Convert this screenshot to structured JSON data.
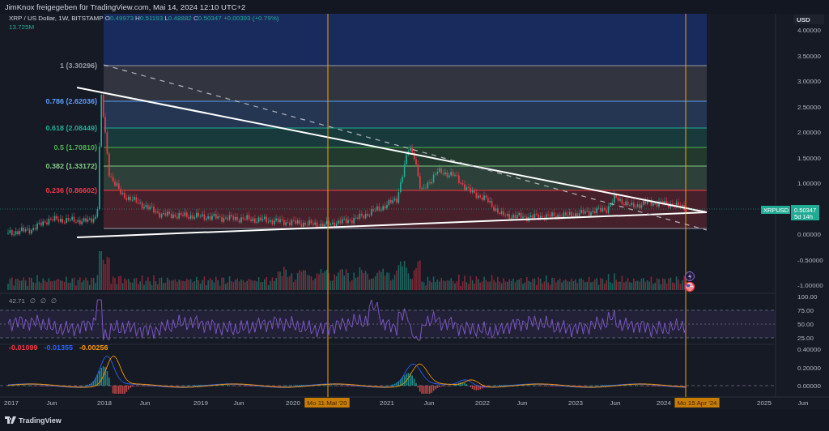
{
  "header": {
    "text": "JimKnox freigegeben für TradingView.com, Mai 14, 2024 12:10 UTC+2"
  },
  "legend": {
    "symbol": "XRP / US Dollar, 1W, BITSTAMP",
    "ohlc": [
      {
        "key": "O",
        "value": "0.49973"
      },
      {
        "key": "H",
        "value": "0.51193"
      },
      {
        "key": "L",
        "value": "0.48882"
      },
      {
        "key": "C",
        "value": "0.50347"
      }
    ],
    "change": "+0.00393 (+0.79%)",
    "volume": "13.725M"
  },
  "price_axis": {
    "unit": "USD",
    "ticks": [
      "4.00000",
      "3.50000",
      "3.00000",
      "2.50000",
      "2.00000",
      "1.50000",
      "1.00000",
      "0.00000",
      "-0.50000",
      "-1.00000"
    ]
  },
  "price_label": {
    "symbol": "XRPUSD",
    "value": "0.50347",
    "countdown": "5d 14h"
  },
  "fibonacci": {
    "levels": [
      {
        "label": "1 (3.30296)",
        "color": "#9598a1"
      },
      {
        "label": "0.786 (2.62036)",
        "color": "#5b9cf6"
      },
      {
        "label": "0.618 (2.08449)",
        "color": "#22ab94"
      },
      {
        "label": "0.5 (1.70810)",
        "color": "#4caf50"
      },
      {
        "label": "0.382 (1.33172)",
        "color": "#81c784"
      },
      {
        "label": "0.236 (0.86602)",
        "color": "#f23645"
      }
    ]
  },
  "rsi": {
    "values": [
      "42.71",
      "∅",
      "∅",
      "∅"
    ],
    "ticks": [
      "100.00",
      "75.00",
      "50.00",
      "25.00"
    ]
  },
  "macd": {
    "values": [
      {
        "text": "-0.01099",
        "color": "#f23645"
      },
      {
        "text": "-0.01355",
        "color": "#2962ff"
      },
      {
        "text": "-0.00256",
        "color": "#ff9800"
      }
    ],
    "ticks": [
      "0.40000",
      "0.20000",
      "0.00000"
    ]
  },
  "time_axis": {
    "ticks": [
      "2017",
      "Jun",
      "2018",
      "Jun",
      "2019",
      "Jun",
      "2020",
      "2021",
      "Jun",
      "2022",
      "Jun",
      "2023",
      "Jun",
      "2024",
      "2025",
      "Jun"
    ],
    "markers": [
      "Mo 11 Mai '20",
      "Mo 15 Apr '24"
    ]
  },
  "footer": {
    "brand": "TradingView"
  }
}
